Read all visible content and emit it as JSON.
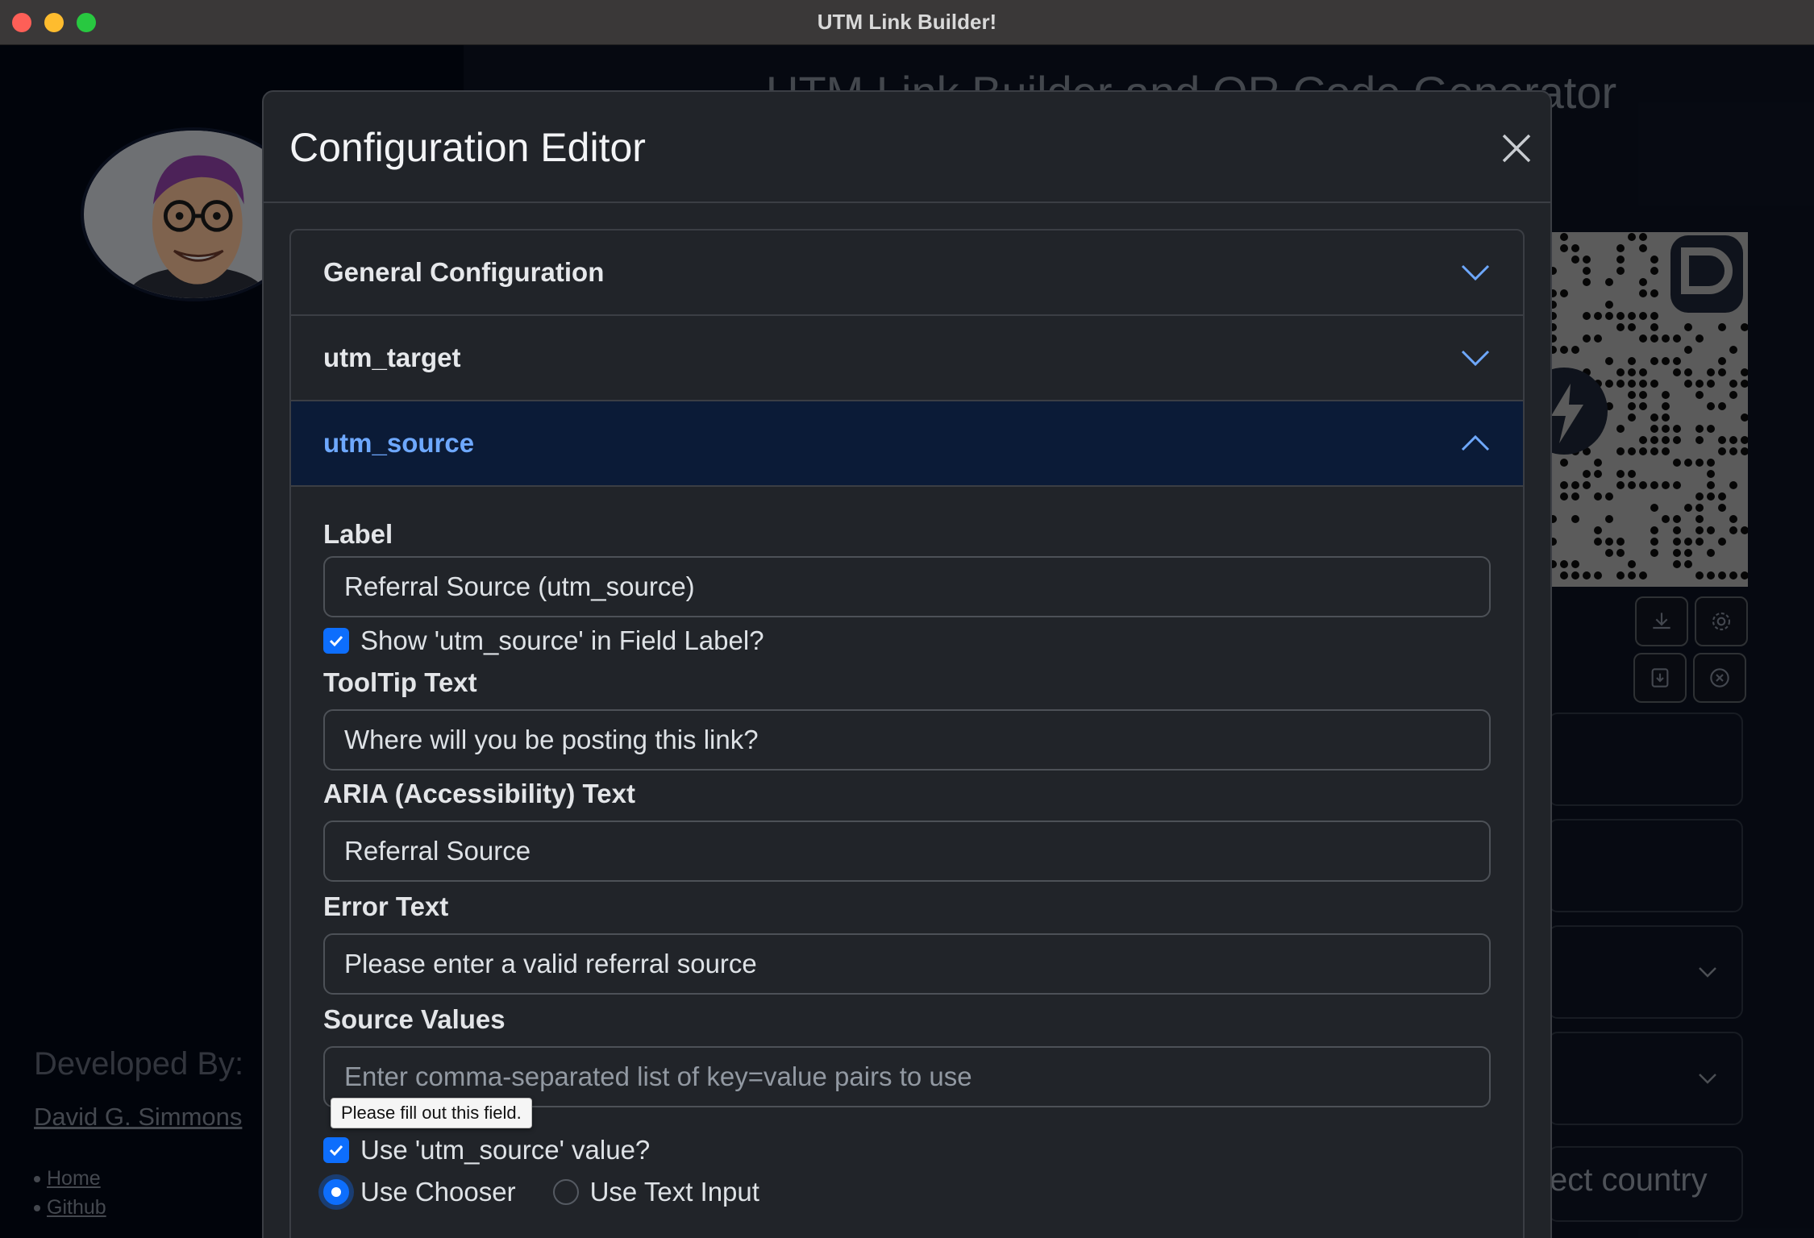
{
  "window": {
    "title": "UTM Link Builder!"
  },
  "background": {
    "heading": "UTM Link Builder and QR Code Generator",
    "developed_by": "Developed By:",
    "developer_name": "David G. Simmons",
    "links": [
      {
        "label": "Home"
      },
      {
        "label": "Github"
      }
    ],
    "country_placeholder_visible": "ect country"
  },
  "modal": {
    "title": "Configuration Editor",
    "sections": [
      {
        "label": "General Configuration",
        "expanded": false
      },
      {
        "label": "utm_target",
        "expanded": false
      },
      {
        "label": "utm_source",
        "expanded": true
      }
    ],
    "fields": {
      "label": {
        "title": "Label",
        "value": "Referral Source (utm_source)"
      },
      "show_in_label": {
        "text": "Show 'utm_source' in Field Label?",
        "checked": true
      },
      "tooltip": {
        "title": "ToolTip Text",
        "value": "Where will you be posting this link?"
      },
      "aria": {
        "title": "ARIA (Accessibility) Text",
        "value": "Referral Source"
      },
      "error": {
        "title": "Error Text",
        "value": "Please enter a valid referral source"
      },
      "source_values": {
        "title": "Source Values",
        "value": "",
        "placeholder": "Enter comma-separated list of key=value pairs to use"
      },
      "use_value": {
        "text": "Use 'utm_source' value?",
        "checked": true
      },
      "mode": {
        "options": [
          {
            "label": "Use Chooser",
            "selected": true
          },
          {
            "label": "Use Text Input",
            "selected": false
          }
        ]
      }
    },
    "validation_tooltip": "Please fill out this field."
  },
  "colors": {
    "accent": "#0d6efd",
    "active_header_text": "#6ea8fe",
    "modal_bg": "#212429"
  }
}
